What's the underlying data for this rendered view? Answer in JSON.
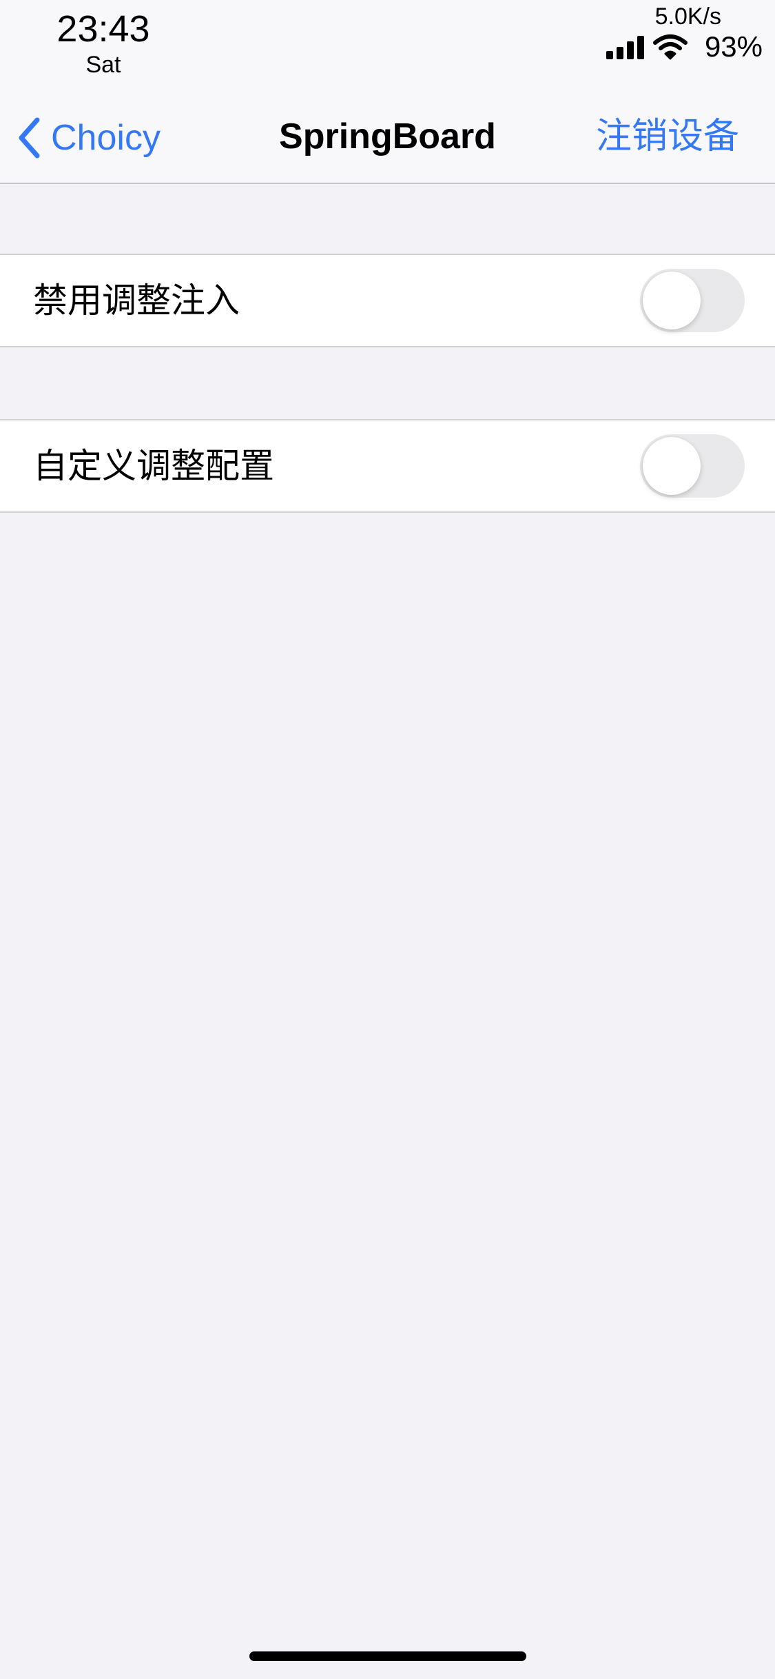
{
  "status_bar": {
    "time": "23:43",
    "day": "Sat",
    "net_speed": "5.0K/s",
    "battery": "93%",
    "icons": [
      "signal-icon",
      "wifi-icon"
    ]
  },
  "nav": {
    "back_label": "Choicy",
    "title": "SpringBoard",
    "right_action": "注销设备",
    "accent_color": "#3478f6"
  },
  "settings": [
    {
      "label": "禁用调整注入",
      "toggle_on": false
    },
    {
      "label": "自定义调整配置",
      "toggle_on": false
    }
  ]
}
